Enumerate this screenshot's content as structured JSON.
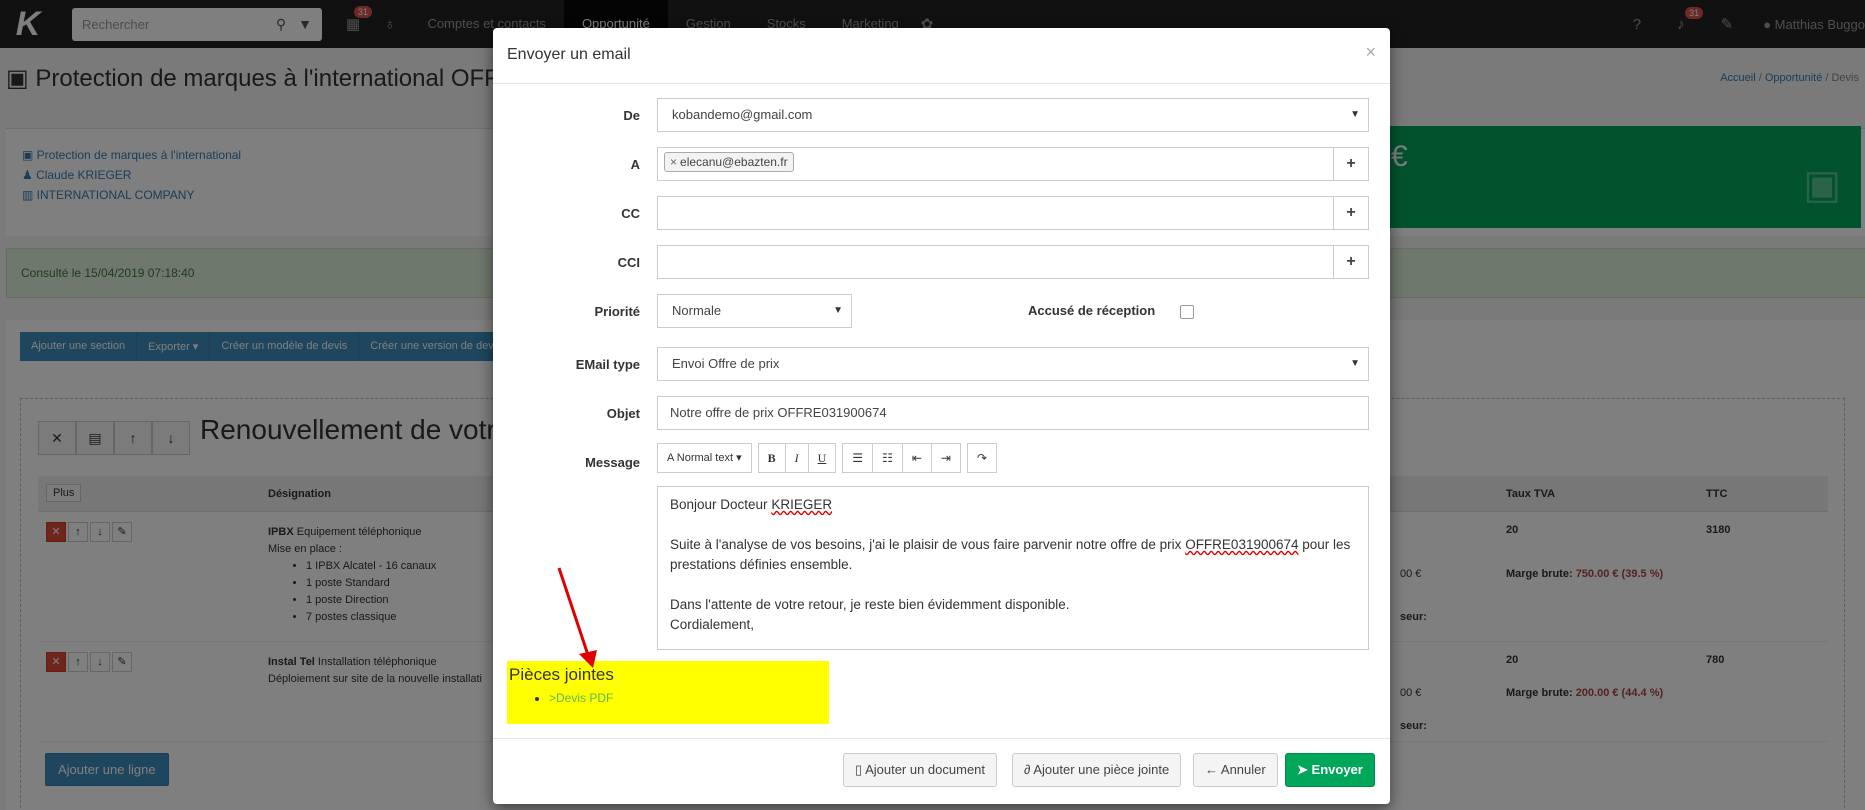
{
  "navbar": {
    "search_placeholder": "Rechercher",
    "calendar_badge": "31",
    "links": [
      "Comptes et contacts",
      "Opportunité",
      "Gestion",
      "Stocks",
      "Marketing"
    ],
    "notif_badge": "31",
    "user": "Matthias Buggo"
  },
  "page": {
    "title": "Protection de marques à l'international OFFRE",
    "breadcrumb": [
      "Accueil",
      "Opportunité",
      "Devis"
    ],
    "links": [
      "Protection de marques à l'international",
      "Claude KRIEGER",
      "INTERNATIONAL COMPANY"
    ],
    "green_symbol": "€",
    "consulted": "Consulté le 15/04/2019 07:18:40",
    "toolbar": [
      "Ajouter une section",
      "Exporter ▾",
      "Créer un modèle de devis",
      "Créer une version de dev"
    ],
    "section_title": "Renouvellement de votr",
    "table_headers": {
      "plus": "Plus",
      "designation": "Désignation",
      "tva": "Taux TVA",
      "ttc": "TTC"
    },
    "rows": [
      {
        "title": "IPBX",
        "title_rest": " Equipement téléphonique",
        "line2": "Mise en place :",
        "items": [
          "1 IPBX Alcatel - 16 canaux",
          "1 poste Standard",
          "1 poste Direction",
          "7 postes classique"
        ],
        "tva": "20",
        "ttc": "3180",
        "partial_amount": "00 €",
        "marge_label": "Marge brute:",
        "marge_value": "750.00 € (39.5 %)",
        "partial_label": "seur:"
      },
      {
        "title": "Instal Tel",
        "title_rest": " Installation téléphonique",
        "line2": "Déploiement sur site de la nouvelle installati",
        "items": [],
        "tva": "20",
        "ttc": "780",
        "partial_amount": "00 €",
        "marge_label": "Marge brute:",
        "marge_value": "200.00 € (44.4 %)",
        "partial_label": "seur:"
      }
    ],
    "add_line": "Ajouter une ligne"
  },
  "modal": {
    "title": "Envoyer un email",
    "close": "×",
    "labels": {
      "from": "De",
      "to": "A",
      "cc": "CC",
      "cci": "CCI",
      "priority": "Priorité",
      "receipt": "Accusé de réception",
      "email_type": "EMail type",
      "subject": "Objet",
      "message": "Message"
    },
    "from_value": "kobandemo@gmail.com",
    "to_tag": "elecanu@ebazten.fr",
    "priority_value": "Normale",
    "email_type_value": "Envoi Offre de prix",
    "subject_value": "Notre offre de prix OFFRE031900674",
    "editor_toolbar": {
      "style": "A Normal text ▾",
      "bold": "B",
      "italic": "I",
      "underline": "U"
    },
    "message": {
      "greeting": "Bonjour Docteur ",
      "greeting_name": "KRIEGER",
      "p1a": "Suite à l'analyse de vos besoins, j'ai le plaisir de vous faire parvenir notre offre de prix ",
      "p1_ref": "OFFRE031900674",
      "p1b": " pour les prestations définies ensemble.",
      "p2": "Dans l'attente de votre retour, je reste bien évidemment disponible.",
      "p3": "Cordialement,"
    },
    "attachments_title": "Pièces jointes",
    "attachments": [
      ">Devis PDF"
    ],
    "buttons": {
      "add_document": "Ajouter un document",
      "add_attachment": "Ajouter une pièce jointe",
      "cancel": "Annuler",
      "send": "Envoyer"
    }
  },
  "colors": {
    "primary": "#3c8dbc",
    "success": "#00a65a",
    "highlight": "#ffff00",
    "arrow": "#e00000"
  }
}
